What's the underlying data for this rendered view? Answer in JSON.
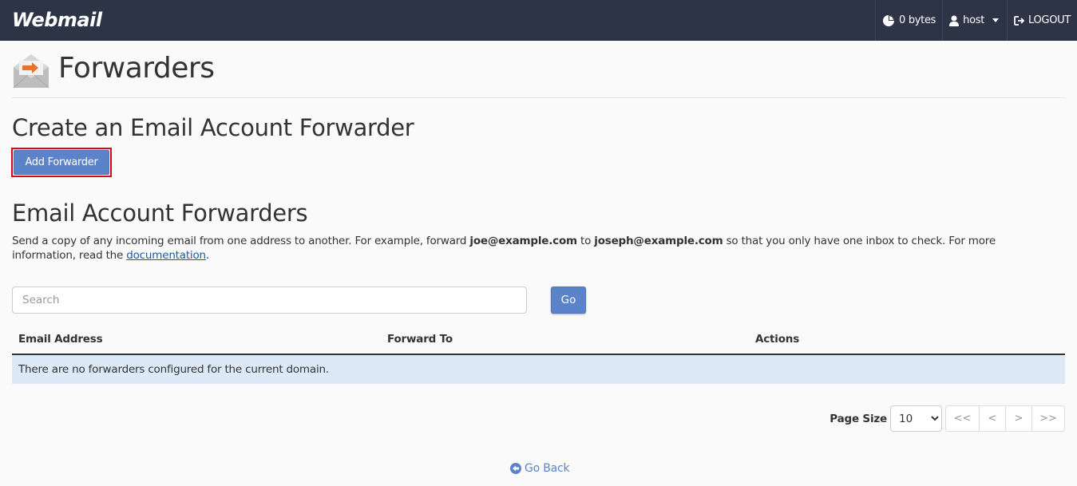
{
  "header": {
    "brand": "Webmail",
    "disk_usage": "0 bytes",
    "user": "host",
    "logout": "LOGOUT"
  },
  "page": {
    "title": "Forwarders",
    "icon": "envelope-forward-icon"
  },
  "create_section": {
    "heading": "Create an Email Account Forwarder",
    "add_button": "Add Forwarder"
  },
  "list_section": {
    "heading": "Email Account Forwarders",
    "desc_1": "Send a copy of any incoming email from one address to another. For example, forward ",
    "desc_email_from": "joe@example.com",
    "desc_2": " to ",
    "desc_email_to": "joseph@example.com",
    "desc_3": " so that you only have one inbox to check. For more information, read the ",
    "desc_link": "documentation",
    "desc_4": "."
  },
  "search": {
    "placeholder": "Search",
    "value": "",
    "go_button": "Go"
  },
  "table": {
    "columns": [
      "Email Address",
      "Forward To",
      "Actions"
    ],
    "empty_message": "There are no forwarders configured for the current domain."
  },
  "pagination": {
    "page_size_label": "Page Size",
    "page_size": "10",
    "first": "<<",
    "prev": "<",
    "next": ">",
    "last": ">>"
  },
  "footer": {
    "go_back": "Go Back"
  },
  "colors": {
    "topbar": "#2d3446",
    "primary": "#5b83c9",
    "highlight_border": "#e0001b",
    "empty_row": "#dde9f7"
  }
}
